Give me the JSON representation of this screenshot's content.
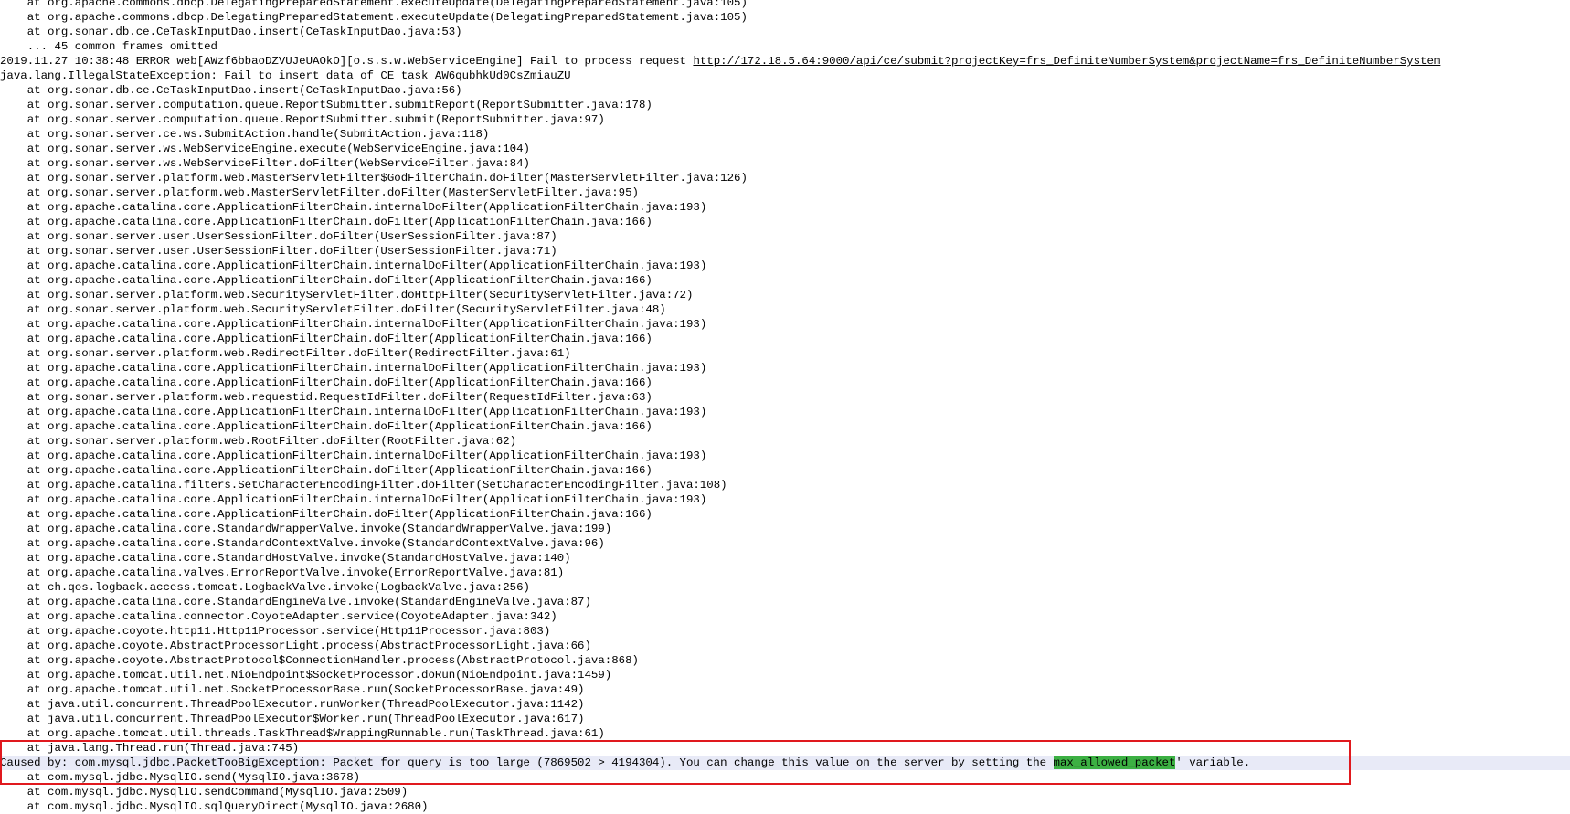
{
  "log": {
    "lines": [
      "    at org.apache.commons.dbcp.DelegatingPreparedStatement.executeUpdate(DelegatingPreparedStatement.java:105)",
      "    at org.apache.commons.dbcp.DelegatingPreparedStatement.executeUpdate(DelegatingPreparedStatement.java:105)",
      "    at org.sonar.db.ce.CeTaskInputDao.insert(CeTaskInputDao.java:53)",
      "    ... 45 common frames omitted",
      null,
      "java.lang.IllegalStateException: Fail to insert data of CE task AW6qubhkUd0CsZmiauZU",
      "    at org.sonar.db.ce.CeTaskInputDao.insert(CeTaskInputDao.java:56)",
      "    at org.sonar.server.computation.queue.ReportSubmitter.submitReport(ReportSubmitter.java:178)",
      "    at org.sonar.server.computation.queue.ReportSubmitter.submit(ReportSubmitter.java:97)",
      "    at org.sonar.server.ce.ws.SubmitAction.handle(SubmitAction.java:118)",
      "    at org.sonar.server.ws.WebServiceEngine.execute(WebServiceEngine.java:104)",
      "    at org.sonar.server.ws.WebServiceFilter.doFilter(WebServiceFilter.java:84)",
      "    at org.sonar.server.platform.web.MasterServletFilter$GodFilterChain.doFilter(MasterServletFilter.java:126)",
      "    at org.sonar.server.platform.web.MasterServletFilter.doFilter(MasterServletFilter.java:95)",
      "    at org.apache.catalina.core.ApplicationFilterChain.internalDoFilter(ApplicationFilterChain.java:193)",
      "    at org.apache.catalina.core.ApplicationFilterChain.doFilter(ApplicationFilterChain.java:166)",
      "    at org.sonar.server.user.UserSessionFilter.doFilter(UserSessionFilter.java:87)",
      "    at org.sonar.server.user.UserSessionFilter.doFilter(UserSessionFilter.java:71)",
      "    at org.apache.catalina.core.ApplicationFilterChain.internalDoFilter(ApplicationFilterChain.java:193)",
      "    at org.apache.catalina.core.ApplicationFilterChain.doFilter(ApplicationFilterChain.java:166)",
      "    at org.sonar.server.platform.web.SecurityServletFilter.doHttpFilter(SecurityServletFilter.java:72)",
      "    at org.sonar.server.platform.web.SecurityServletFilter.doFilter(SecurityServletFilter.java:48)",
      "    at org.apache.catalina.core.ApplicationFilterChain.internalDoFilter(ApplicationFilterChain.java:193)",
      "    at org.apache.catalina.core.ApplicationFilterChain.doFilter(ApplicationFilterChain.java:166)",
      "    at org.sonar.server.platform.web.RedirectFilter.doFilter(RedirectFilter.java:61)",
      "    at org.apache.catalina.core.ApplicationFilterChain.internalDoFilter(ApplicationFilterChain.java:193)",
      "    at org.apache.catalina.core.ApplicationFilterChain.doFilter(ApplicationFilterChain.java:166)",
      "    at org.sonar.server.platform.web.requestid.RequestIdFilter.doFilter(RequestIdFilter.java:63)",
      "    at org.apache.catalina.core.ApplicationFilterChain.internalDoFilter(ApplicationFilterChain.java:193)",
      "    at org.apache.catalina.core.ApplicationFilterChain.doFilter(ApplicationFilterChain.java:166)",
      "    at org.sonar.server.platform.web.RootFilter.doFilter(RootFilter.java:62)",
      "    at org.apache.catalina.core.ApplicationFilterChain.internalDoFilter(ApplicationFilterChain.java:193)",
      "    at org.apache.catalina.core.ApplicationFilterChain.doFilter(ApplicationFilterChain.java:166)",
      "    at org.apache.catalina.filters.SetCharacterEncodingFilter.doFilter(SetCharacterEncodingFilter.java:108)",
      "    at org.apache.catalina.core.ApplicationFilterChain.internalDoFilter(ApplicationFilterChain.java:193)",
      "    at org.apache.catalina.core.ApplicationFilterChain.doFilter(ApplicationFilterChain.java:166)",
      "    at org.apache.catalina.core.StandardWrapperValve.invoke(StandardWrapperValve.java:199)",
      "    at org.apache.catalina.core.StandardContextValve.invoke(StandardContextValve.java:96)",
      "    at org.apache.catalina.core.StandardHostValve.invoke(StandardHostValve.java:140)",
      "    at org.apache.catalina.valves.ErrorReportValve.invoke(ErrorReportValve.java:81)",
      "    at ch.qos.logback.access.tomcat.LogbackValve.invoke(LogbackValve.java:256)",
      "    at org.apache.catalina.core.StandardEngineValve.invoke(StandardEngineValve.java:87)",
      "    at org.apache.catalina.connector.CoyoteAdapter.service(CoyoteAdapter.java:342)",
      "    at org.apache.coyote.http11.Http11Processor.service(Http11Processor.java:803)",
      "    at org.apache.coyote.AbstractProcessorLight.process(AbstractProcessorLight.java:66)",
      "    at org.apache.coyote.AbstractProtocol$ConnectionHandler.process(AbstractProtocol.java:868)",
      "    at org.apache.tomcat.util.net.NioEndpoint$SocketProcessor.doRun(NioEndpoint.java:1459)",
      "    at org.apache.tomcat.util.net.SocketProcessorBase.run(SocketProcessorBase.java:49)",
      "    at java.util.concurrent.ThreadPoolExecutor.runWorker(ThreadPoolExecutor.java:1142)",
      "    at java.util.concurrent.ThreadPoolExecutor$Worker.run(ThreadPoolExecutor.java:617)",
      "    at org.apache.tomcat.util.threads.TaskThread$WrappingRunnable.run(TaskThread.java:61)",
      "    at java.lang.Thread.run(Thread.java:745)",
      null,
      "    at com.mysql.jdbc.MysqlIO.send(MysqlIO.java:3678)",
      "    at com.mysql.jdbc.MysqlIO.sendCommand(MysqlIO.java:2509)",
      "    at com.mysql.jdbc.MysqlIO.sqlQueryDirect(MysqlIO.java:2680)"
    ],
    "error_line": {
      "prefix": "2019.11.27 10:38:48 ERROR web[AWzf6bbaoDZVUJeUAOkO][o.s.s.w.WebServiceEngine] Fail to process request ",
      "url": "http://172.18.5.64:9000/api/ce/submit?projectKey=frs_DefiniteNumberSystem&projectName=frs_DefiniteNumberSystem"
    },
    "caused_by_line": {
      "before": "Caused by: com.mysql.jdbc.PacketTooBigException: Packet for query is too large (7869502 > 4194304). You can change this value on the server by setting the ",
      "match": "max_allowed_packet",
      "after": "' variable."
    }
  },
  "colors": {
    "annotation_box": "#e0191e",
    "find_match_highlight": "#3cb043",
    "current_line_highlight": "#e8eaf7"
  }
}
